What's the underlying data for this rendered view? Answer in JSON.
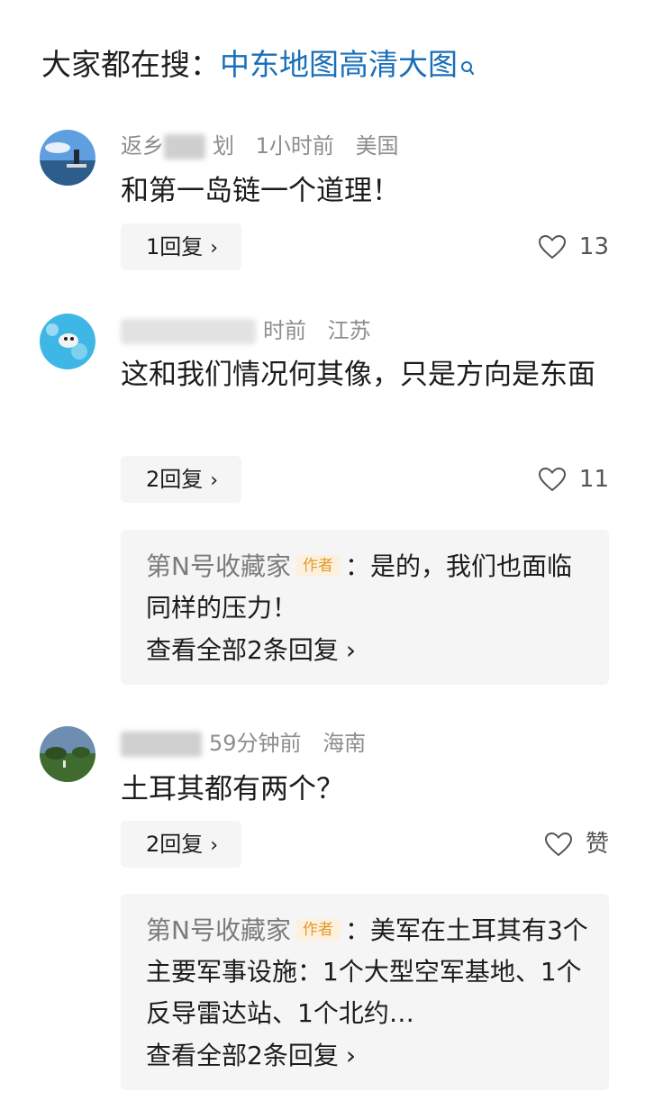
{
  "search": {
    "label": "大家都在搜：",
    "query": "中东地图高清大图",
    "icon": "search-icon"
  },
  "comments": [
    {
      "user_visible": "返乡",
      "user_visible_end": "划",
      "time": "1小时前",
      "location": "美国",
      "text": "和第一岛链一个道理！",
      "reply_label": "1回复",
      "likes": "13"
    },
    {
      "time": "时前",
      "location": "江苏",
      "text": "这和我们情况何其像，只是方向是东面",
      "reply_label": "2回复",
      "likes": "11",
      "sub_reply": {
        "author": "第N号收藏家",
        "badge": "作者",
        "text": "：是的，我们也面临同样的压力！",
        "view_all": "查看全部2条回复"
      }
    },
    {
      "time": "59分钟前",
      "location": "海南",
      "text": "土耳其都有两个？",
      "reply_label": "2回复",
      "likes": "赞",
      "sub_reply": {
        "author": "第N号收藏家",
        "badge": "作者",
        "text": "：美军在土耳其有3个主要军事设施：1个大型空军基地、1个反导雷达站、1个北约…",
        "view_all": "查看全部2条回复"
      }
    }
  ],
  "colors": {
    "link": "#1a6fb8",
    "meta": "#8d8d8d",
    "badge_text": "#e19a2e",
    "badge_bg": "#fdf1de",
    "panel_bg": "#f5f5f5"
  }
}
